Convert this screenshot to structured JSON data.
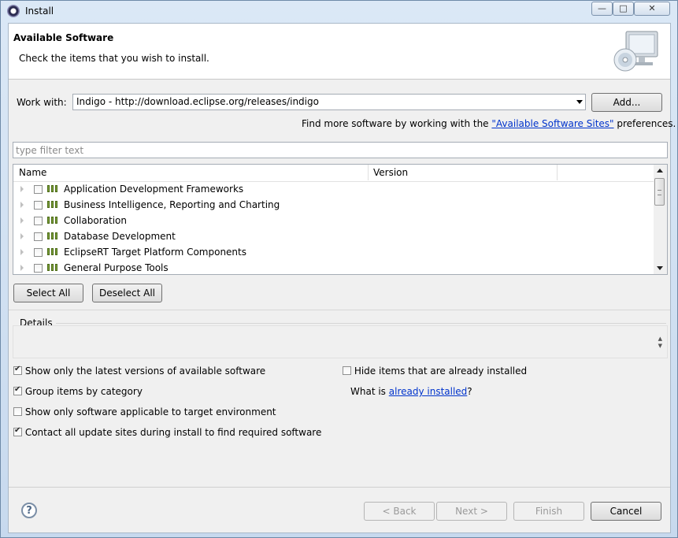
{
  "window": {
    "title": "Install",
    "minimize": "—",
    "maximize": "□",
    "close": "✕"
  },
  "header": {
    "title": "Available Software",
    "subtitle": "Check the items that you wish to install."
  },
  "work_with": {
    "label": "Work with:",
    "value": "Indigo - http://download.eclipse.org/releases/indigo",
    "add_button": "Add..."
  },
  "sites_hint": {
    "prefix": "Find more software by working with the ",
    "link": "\"Available Software Sites\"",
    "suffix": " preferences."
  },
  "filter": {
    "placeholder": "type filter text"
  },
  "tree": {
    "columns": [
      "Name",
      "Version"
    ],
    "items": [
      {
        "label": "Application Development Frameworks",
        "checked": false
      },
      {
        "label": "Business Intelligence, Reporting and Charting",
        "checked": false
      },
      {
        "label": "Collaboration",
        "checked": false
      },
      {
        "label": "Database Development",
        "checked": false
      },
      {
        "label": "EclipseRT Target Platform Components",
        "checked": false
      },
      {
        "label": "General Purpose Tools",
        "checked": false
      }
    ]
  },
  "selection_buttons": {
    "select_all": "Select All",
    "deselect_all": "Deselect All"
  },
  "details": {
    "title": "Details"
  },
  "options": {
    "latest_versions": {
      "label": "Show only the latest versions of available software",
      "checked": true
    },
    "group_by_category": {
      "label": "Group items by category",
      "checked": true
    },
    "target_env": {
      "label": "Show only software applicable to target environment",
      "checked": false
    },
    "contact_sites": {
      "label": "Contact all update sites during install to find required software",
      "checked": true
    },
    "hide_installed": {
      "label": "Hide items that are already installed",
      "checked": false
    },
    "what_is": {
      "prefix": "What is ",
      "link": "already installed",
      "suffix": "?"
    }
  },
  "footer": {
    "help": "?",
    "back": "< Back",
    "next": "Next >",
    "finish": "Finish",
    "cancel": "Cancel"
  },
  "colors": {
    "link": "#0033cc",
    "category_icon": "#7fa23b"
  }
}
